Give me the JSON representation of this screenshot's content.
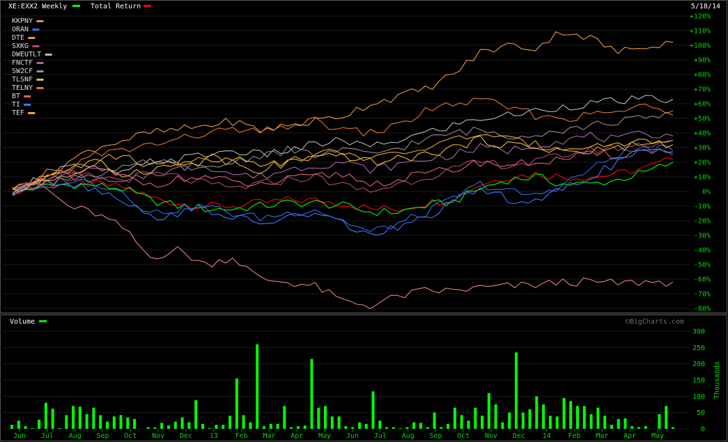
{
  "header": {
    "symbol_label": "XE:EXX2 Weekly",
    "symbol_color": "#00ff00",
    "total_return_label": "Total Return",
    "total_return_color": "#ff0000",
    "date": "5/18/14"
  },
  "volume_label": "Volume",
  "volume_color": "#00ff00",
  "watermark": "©BigCharts.com",
  "legend": [
    {
      "name": "KKPNY",
      "color": "#e8827a"
    },
    {
      "name": "ORAN",
      "color": "#2f6fe8"
    },
    {
      "name": "DTE",
      "color": "#e89a3c"
    },
    {
      "name": "SXKG",
      "color": "#b0496a"
    },
    {
      "name": "DWEUTLT",
      "color": "#b8b8b8"
    },
    {
      "name": "FNCTF",
      "color": "#a86aa8"
    },
    {
      "name": "SW2CF",
      "color": "#909090"
    },
    {
      "name": "TLSNF",
      "color": "#f0c020"
    },
    {
      "name": "TELNY",
      "color": "#e8742a"
    },
    {
      "name": "BT",
      "color": "#e0607a"
    },
    {
      "name": "TI",
      "color": "#3a7aff"
    },
    {
      "name": "TEF",
      "color": "#e8a840"
    }
  ],
  "chart_data": [
    {
      "type": "line",
      "title": "XE:EXX2 Weekly",
      "ylim": [
        -80,
        120
      ],
      "y_ticks": [
        "+120%",
        "+110%",
        "+100%",
        "+90%",
        "+80%",
        "+70%",
        "+60%",
        "+50%",
        "+40%",
        "+30%",
        "+20%",
        "+10%",
        "0%",
        "-10%",
        "-20%",
        "-30%",
        "-40%",
        "-50%",
        "-60%",
        "-70%",
        "-80%"
      ],
      "x_labels": [
        "Jun",
        "Jul",
        "Aug",
        "Sep",
        "Oct",
        "Nov",
        "Dec",
        "13",
        "Feb",
        "Mar",
        "Apr",
        "May",
        "Jun",
        "Jul",
        "Aug",
        "Sep",
        "Oct",
        "Nov",
        "Dec",
        "14",
        "Feb",
        "Mar",
        "Apr",
        "May"
      ],
      "series": [
        {
          "name": "Total Return",
          "color": "#ff0000",
          "values": [
            0,
            4,
            6,
            5,
            3,
            -4,
            -8,
            -10,
            -10,
            -8,
            -6,
            -6,
            -8,
            -12,
            -12,
            -8,
            -5,
            5,
            10,
            12,
            10,
            10,
            12,
            16,
            22
          ]
        },
        {
          "name": "XE:EXX2 Weekly",
          "color": "#00ff00",
          "values": [
            0,
            3,
            5,
            4,
            2,
            -6,
            -10,
            -12,
            -12,
            -10,
            -8,
            -8,
            -10,
            -14,
            -14,
            -10,
            -7,
            2,
            8,
            10,
            5,
            5,
            8,
            13,
            20
          ]
        },
        {
          "name": "KKPNY",
          "color": "#e8827a",
          "values": [
            0,
            5,
            -10,
            -15,
            -25,
            -45,
            -40,
            -50,
            -45,
            -60,
            -62,
            -65,
            -75,
            -78,
            -72,
            -68,
            -68,
            -66,
            -65,
            -64,
            -62,
            -62,
            -63,
            -62,
            -62
          ]
        },
        {
          "name": "ORAN",
          "color": "#2f6fe8",
          "values": [
            0,
            5,
            8,
            6,
            0,
            -15,
            -12,
            -10,
            -15,
            -18,
            -15,
            -12,
            -20,
            -28,
            -22,
            -15,
            -5,
            5,
            0,
            -3,
            5,
            15,
            25,
            30,
            28
          ]
        },
        {
          "name": "DTE",
          "color": "#e89a3c",
          "values": [
            0,
            10,
            20,
            30,
            35,
            40,
            42,
            45,
            48,
            42,
            45,
            48,
            52,
            60,
            65,
            70,
            80,
            95,
            100,
            98,
            110,
            105,
            95,
            100,
            102
          ]
        },
        {
          "name": "SXKG",
          "color": "#b0496a",
          "values": [
            0,
            8,
            12,
            10,
            8,
            12,
            10,
            5,
            2,
            5,
            8,
            10,
            4,
            0,
            5,
            10,
            15,
            20,
            18,
            20,
            25,
            28,
            30,
            32,
            35
          ]
        },
        {
          "name": "DWEUTLT",
          "color": "#b8b8b8",
          "values": [
            0,
            10,
            18,
            15,
            12,
            20,
            22,
            25,
            28,
            25,
            28,
            32,
            35,
            30,
            35,
            40,
            45,
            50,
            52,
            55,
            58,
            60,
            62,
            63,
            63
          ]
        },
        {
          "name": "FNCTF",
          "color": "#a86aa8",
          "values": [
            0,
            5,
            10,
            8,
            5,
            12,
            15,
            18,
            12,
            10,
            15,
            18,
            20,
            15,
            18,
            22,
            25,
            30,
            28,
            32,
            35,
            38,
            35,
            40,
            38
          ]
        },
        {
          "name": "SW2CF",
          "color": "#909090",
          "values": [
            0,
            6,
            10,
            12,
            15,
            20,
            18,
            15,
            20,
            25,
            28,
            25,
            28,
            25,
            30,
            35,
            40,
            42,
            38,
            40,
            42,
            45,
            48,
            50,
            52
          ]
        },
        {
          "name": "TLSNF",
          "color": "#f0c020",
          "values": [
            0,
            10,
            15,
            20,
            12,
            15,
            18,
            20,
            22,
            18,
            20,
            22,
            25,
            20,
            22,
            25,
            30,
            35,
            32,
            30,
            28,
            30,
            32,
            35,
            32
          ]
        },
        {
          "name": "TELNY",
          "color": "#e8742a",
          "values": [
            0,
            8,
            15,
            25,
            28,
            32,
            35,
            40,
            42,
            40,
            45,
            48,
            42,
            40,
            45,
            55,
            60,
            62,
            58,
            52,
            50,
            52,
            55,
            58,
            55
          ]
        },
        {
          "name": "BT",
          "color": "#e0607a",
          "values": [
            0,
            6,
            12,
            15,
            10,
            5,
            8,
            10,
            6,
            4,
            8,
            10,
            12,
            5,
            8,
            12,
            15,
            20,
            18,
            20,
            22,
            25,
            25,
            28,
            27
          ]
        },
        {
          "name": "TI",
          "color": "#3a7aff",
          "values": [
            0,
            4,
            6,
            2,
            -5,
            -18,
            -15,
            -12,
            -18,
            -22,
            -18,
            -15,
            -22,
            -30,
            -25,
            -18,
            -8,
            2,
            -5,
            -8,
            2,
            10,
            20,
            28,
            25
          ]
        },
        {
          "name": "TEF",
          "color": "#e8a840",
          "values": [
            0,
            8,
            12,
            20,
            25,
            18,
            20,
            25,
            20,
            15,
            20,
            25,
            28,
            22,
            25,
            30,
            35,
            40,
            35,
            32,
            30,
            28,
            30,
            33,
            35
          ]
        }
      ]
    },
    {
      "type": "bar",
      "title": "Volume",
      "ylabel": "Thousands",
      "ylim": [
        0,
        300
      ],
      "y_ticks": [
        "300",
        "250",
        "200",
        "150",
        "100",
        "50",
        "0"
      ],
      "x_labels": [
        "Jun",
        "Jul",
        "Aug",
        "Sep",
        "Oct",
        "Nov",
        "Dec",
        "13",
        "Feb",
        "Mar",
        "Apr",
        "May",
        "Jun",
        "Jul",
        "Aug",
        "Sep",
        "Oct",
        "Nov",
        "Dec",
        "14",
        "Feb",
        "Mar",
        "Apr",
        "May"
      ],
      "values": [
        12,
        25,
        8,
        2,
        28,
        80,
        62,
        2,
        42,
        70,
        68,
        45,
        65,
        42,
        22,
        38,
        42,
        35,
        30,
        0,
        5,
        4,
        18,
        10,
        22,
        35,
        20,
        88,
        15,
        2,
        12,
        12,
        40,
        155,
        42,
        20,
        260,
        8,
        15,
        15,
        70,
        5,
        8,
        10,
        215,
        65,
        70,
        38,
        38,
        8,
        5,
        20,
        15,
        115,
        25,
        5,
        5,
        2,
        5,
        20,
        18,
        5,
        50,
        5,
        15,
        65,
        42,
        25,
        65,
        40,
        110,
        75,
        20,
        50,
        235,
        50,
        60,
        100,
        75,
        40,
        38,
        95,
        85,
        70,
        70,
        45,
        65,
        40,
        12,
        30,
        32,
        8,
        5,
        8,
        0,
        45,
        70,
        5
      ]
    }
  ]
}
